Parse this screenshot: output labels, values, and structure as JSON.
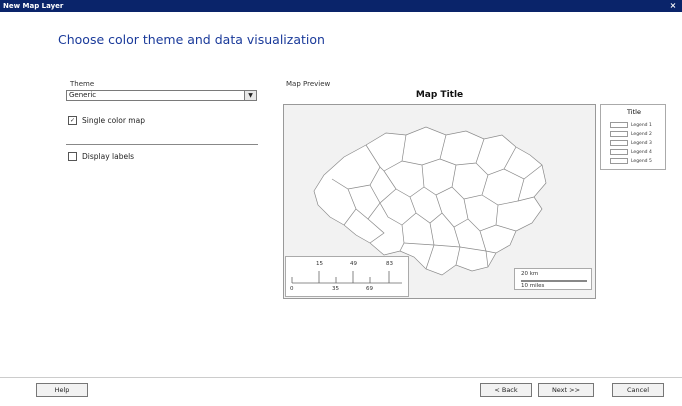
{
  "window": {
    "title": "New Map Layer",
    "close_glyph": "×"
  },
  "page": {
    "heading": "Choose color theme and data visualization"
  },
  "theme": {
    "label": "Theme",
    "selected": "Generic",
    "dropdown_glyph": "▼"
  },
  "options": {
    "single_color_map": {
      "label": "Single color map",
      "checked": true,
      "check_glyph": "✓"
    },
    "display_labels": {
      "label": "Display labels",
      "checked": false
    }
  },
  "preview": {
    "label": "Map Preview",
    "map_title": "Map Title",
    "legend": {
      "title": "Title",
      "items": [
        "Legend 1",
        "Legend 2",
        "Legend 3",
        "Legend 4",
        "Legend 5"
      ]
    },
    "color_scale": {
      "top_labels": [
        "15",
        "49",
        "83"
      ],
      "bottom_labels": [
        "0",
        "35",
        "69"
      ]
    },
    "distance_scale": {
      "top_label": "20 km",
      "bottom_label": "10 miles"
    }
  },
  "buttons": {
    "help": "Help",
    "back": "< Back",
    "next": "Next >>",
    "cancel": "Cancel"
  },
  "colors": {
    "title_bar": "#0a246a",
    "heading": "#1a3a9a"
  }
}
